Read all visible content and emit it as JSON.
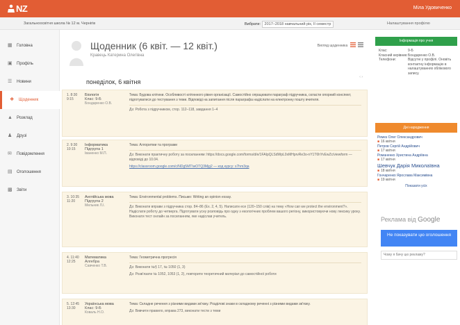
{
  "brand": {
    "name": "NZ",
    "accent": "#e25d34"
  },
  "user": {
    "name": "Міла Удовиченко"
  },
  "subbar": {
    "school": "Загальноосвітня школа № 12 м. Чернігів",
    "period_prefix": "Вибрати:",
    "period_value": "2017–2018 навчальний рік, II семестр",
    "right_link": "Налаштування профілю"
  },
  "nav": [
    {
      "label": "Головна",
      "icon": "grid-icon"
    },
    {
      "label": "Профіль",
      "icon": "profile-icon"
    },
    {
      "label": "Новини",
      "icon": "news-icon"
    },
    {
      "label": "Щоденник",
      "icon": "diary-icon",
      "active": true
    },
    {
      "label": "Розклад",
      "icon": "schedule-icon"
    },
    {
      "label": "Друзі",
      "icon": "friends-icon"
    },
    {
      "label": "Повідомлення",
      "icon": "messages-icon"
    },
    {
      "label": "Оголошення",
      "icon": "announce-icon"
    },
    {
      "label": "Звіти",
      "icon": "reports-icon"
    }
  ],
  "diary": {
    "title": "Щоденник (6 квіт. — 12 квіт.)",
    "student": "Кравець Катерина Олегівна",
    "toolbar_label": "Вигляд щоденника",
    "day": "понеділок, 6 квітня",
    "day_nav": "‹ ›"
  },
  "lessons": [
    {
      "num": "1. 8:30",
      "num2": "9:15",
      "subject": "Біологія",
      "group": "Клас: 9-Б",
      "teacher": "Бондаренко О.В.",
      "lines": [
        "Тема: Будова клітини. Особливості клітинного рівня організації. Самостійно опрацювати параграф підручника, скласти опорний конспект, підготуватися до тестування з теми. Відповіді на запитання після параграфа надіслати на електронну пошту вчителя.",
        "Дз: Робота з підручником, стор. 112–118, завдання 1–4"
      ]
    },
    {
      "num": "2. 9:30",
      "num2": "10:15",
      "subject": "Інформатика",
      "group": "Підгрупа 1",
      "teacher": "Іваненко М.П.",
      "lines": [
        "Тема: Алгоритми та програми",
        "Дз: Виконати практичну роботу за посиланням: https://docs.google.com/forms/d/e/1FAIpQLSdWpL0xMHprvRe3o-nY1T6hYvEwZc/viewform — відповіді до 10.04.",
        "https://classroom.google.com/c/NDg5MTIwOTQ3Mjg2 — код курсу: x7hm3qa"
      ]
    },
    {
      "num": "3. 10:35",
      "num2": "11:20",
      "subject": "Англійська мова",
      "group": "Підгрупа 2",
      "teacher": "Мельник Л.І.",
      "lines": [
        "Тема: Environmental problems. Письмо: Writing an opinion essay.",
        "Дз: Виконати вправи з підручника стор. 84–86 (Ex. 2, 4, 5). Написати есе (120–150 слів) на тему «How can we protect the environment?». Надіслати роботу до четверга. Підготувати усну розповідь про одну з екологічних проблем вашого регіону, використовуючи нову лексику уроку. Виконати тест онлайн за посиланням, яке надіслав учитель."
      ]
    },
    {
      "num": "4. 11:40",
      "num2": "12:25",
      "subject": "Математика",
      "group": "Алгебра",
      "teacher": "Савченко Т.В.",
      "lines": [
        "Тема: Геометрична прогресія",
        "Дз: Виконати №§ 17, № 1050 (1, 3)",
        "Дз: Розв'язати № 1052, 1053 (1, 2), повторити теоретичний матеріал до самостійної роботи"
      ]
    },
    {
      "num": "5. 12:45",
      "num2": "13:30",
      "subject": "Українська мова",
      "group": "Клас: 9-Б",
      "teacher": "Коваль Н.О.",
      "lines": [
        "Тема: Складне речення з різними видами зв'язку. Розділові знаки в складному реченні з різними видами зв'язку.",
        "Дз: Вивчити правило, вправа 273, виконати тести з теми"
      ]
    }
  ],
  "info_panel": {
    "header": "Інформація про учня",
    "rows": [
      {
        "k": "Клас:",
        "v": "9-Б"
      },
      {
        "k": "Класний керівник:",
        "v": "Бондаренко О.В."
      },
      {
        "k": "Телефони:",
        "v": "Відсутні у профілі. Оновіть контактну інформацію в налаштуваннях облікового запису."
      }
    ]
  },
  "birthdays": {
    "header": "Дні народження",
    "items": [
      {
        "name": "Ремез Олег Олександрович",
        "date": "16 квітня",
        "big": false
      },
      {
        "name": "Петров Сергій Андрійович",
        "date": "17 квітня",
        "big": false
      },
      {
        "name": "Романенко Христина Андріївна",
        "date": "17 квітня",
        "big": false
      },
      {
        "name": "Шевчук Дарія Миколаївна",
        "date": "18 квітня",
        "big": true
      },
      {
        "name": "Гончаренко Ярослава Максимівна",
        "date": "19 квітня",
        "big": false
      }
    ],
    "more": "Показати усіх"
  },
  "ad": {
    "label": "Реклама від",
    "brand": "Google",
    "button": "Не показувати цю оголошення",
    "why": "Чому я бачу цю рекламу?"
  }
}
